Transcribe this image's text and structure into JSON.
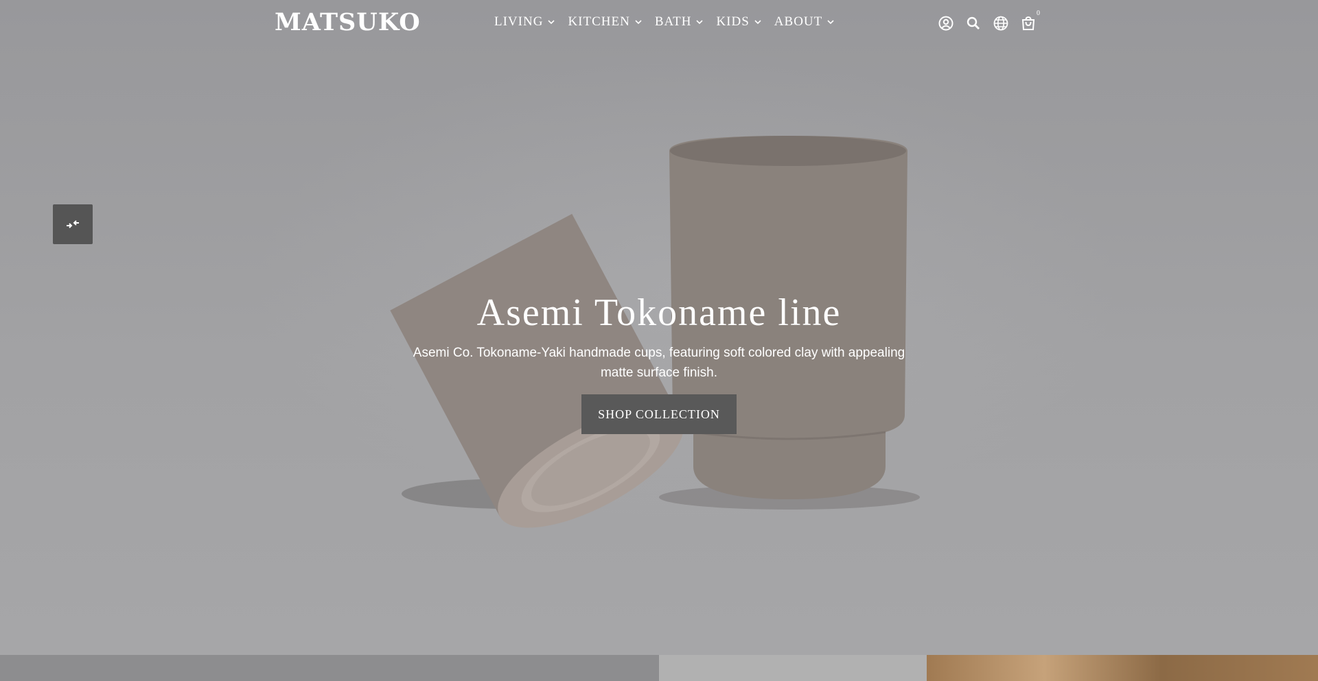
{
  "header": {
    "logo": "MATSUKO",
    "nav": [
      {
        "label": "LIVING"
      },
      {
        "label": "KITCHEN"
      },
      {
        "label": "BATH"
      },
      {
        "label": "KIDS"
      },
      {
        "label": "ABOUT"
      }
    ],
    "icons": [
      "account-icon",
      "search-icon",
      "globe-icon",
      "cart-icon"
    ],
    "cart_count": "0"
  },
  "hero": {
    "title": "Asemi Tokoname line",
    "subtitle": "Asemi Co. Tokoname-Yaki handmade cups, featuring soft colored clay with appealing matte surface finish.",
    "cta": "SHOP COLLECTION"
  },
  "colors": {
    "overlay": "#9c9c9e",
    "button": "#595959",
    "side_button": "#555555",
    "cup": "#8b827c"
  }
}
